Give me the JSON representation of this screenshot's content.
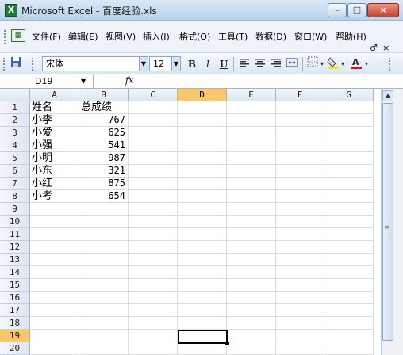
{
  "window": {
    "app_icon": "X",
    "title": "Microsoft Excel - 百度经验.xls",
    "min_label": "–",
    "max_label": "□",
    "close_label": "×"
  },
  "menu": {
    "items": [
      "文件(F)",
      "编辑(E)",
      "视图(V)",
      "插入(I)",
      "格式(O)",
      "工具(T)",
      "数据(D)",
      "窗口(W)",
      "帮助(H)"
    ],
    "doc_min": "_",
    "doc_restore": "♂",
    "doc_close": "×"
  },
  "toolbar": {
    "font_name": "宋体",
    "font_size": "12",
    "bold": "B",
    "italic": "I",
    "underline": "U"
  },
  "formula_bar": {
    "name_box": "D19",
    "fx_label": "fx"
  },
  "sheet": {
    "columns": [
      "A",
      "B",
      "C",
      "D",
      "E",
      "F",
      "G"
    ],
    "active_column": "D",
    "active_row": "19",
    "rows": [
      "1",
      "2",
      "3",
      "4",
      "5",
      "6",
      "7",
      "8",
      "9",
      "10",
      "11",
      "12",
      "13",
      "14",
      "15",
      "16",
      "17",
      "18",
      "19",
      "20"
    ],
    "header": [
      "姓名",
      "总成绩"
    ],
    "records": [
      {
        "name": "小李",
        "score": "767"
      },
      {
        "name": "小爱",
        "score": "625"
      },
      {
        "name": "小强",
        "score": "541"
      },
      {
        "name": "小明",
        "score": "987"
      },
      {
        "name": "小东",
        "score": "321"
      },
      {
        "name": "小红",
        "score": "875"
      },
      {
        "name": "小考",
        "score": "654"
      }
    ]
  },
  "colors": {
    "active_header": "#f8c766",
    "title_bar": "#c9dcf0",
    "gridline": "#dadcdd"
  }
}
